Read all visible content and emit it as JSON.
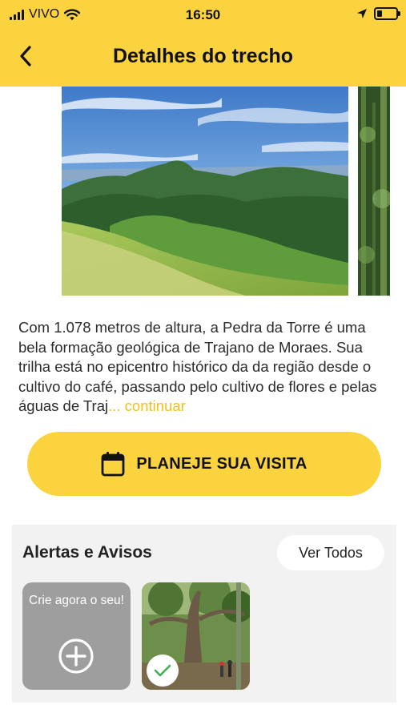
{
  "status_bar": {
    "carrier": "VIVO",
    "time": "16:50",
    "battery_level": 0.25,
    "icons": [
      "signal-icon",
      "wifi-icon",
      "location-arrow-icon",
      "battery-icon"
    ]
  },
  "header": {
    "title": "Detalhes do trecho",
    "back_icon": "chevron-left-icon",
    "background_color": "#fbd33e"
  },
  "gallery": {
    "images": [
      "mountain-landscape-photo",
      "forest-photo"
    ]
  },
  "description": {
    "text": "Com 1.078 metros de altura, a Pedra da Torre é uma bela formação geológica de Trajano de Moraes. Sua trilha está no epicentro histórico da da região desde o cultivo do café, passando pelo cultivo de flores e pelas águas de Traj",
    "ellipsis": "...",
    "more_link": "continuar",
    "link_color": "#f0c01a"
  },
  "plan_button": {
    "label": "PLANEJE SUA VISITA",
    "icon": "calendar-icon"
  },
  "alerts": {
    "title": "Alertas e Avisos",
    "see_all": "Ver Todos",
    "create_card": {
      "text": "Crie agora o seu!",
      "icon": "plus-circle-icon"
    },
    "items": [
      {
        "image": "tree-trail-photo",
        "status_icon": "check-icon",
        "status_color": "#3fae55"
      }
    ]
  }
}
